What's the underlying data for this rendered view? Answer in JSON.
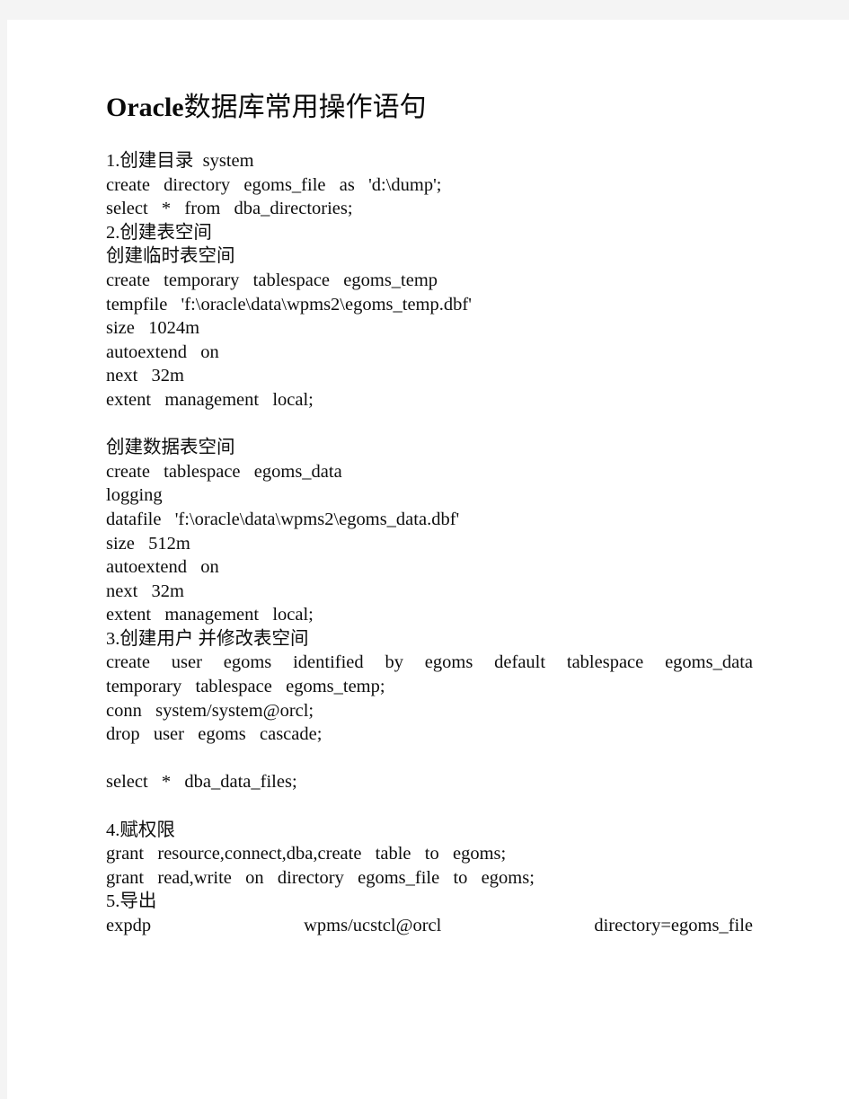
{
  "page": {
    "title_latin": "Oracle",
    "title_cjk": "数据库常用操作语句"
  },
  "document": {
    "lines": [
      {
        "text": "1.创建目录  system",
        "style": "cjk"
      },
      {
        "text": "create  directory  egoms_file  as  'd:\\dump';",
        "style": "plain"
      },
      {
        "text": "select  *  from  dba_directories;",
        "style": "plain"
      },
      {
        "text": "2.创建表空间",
        "style": "cjk"
      },
      {
        "text": "创建临时表空间",
        "style": "cjk"
      },
      {
        "text": "create  temporary  tablespace  egoms_temp",
        "style": "plain"
      },
      {
        "text": "tempfile  'f:\\oracle\\data\\wpms2\\egoms_temp.dbf'",
        "style": "plain"
      },
      {
        "text": "size  1024m",
        "style": "plain"
      },
      {
        "text": "autoextend  on",
        "style": "plain"
      },
      {
        "text": "next  32m",
        "style": "plain"
      },
      {
        "text": "extent  management  local;",
        "style": "plain"
      },
      {
        "text": "",
        "style": "blank"
      },
      {
        "text": "创建数据表空间",
        "style": "cjk"
      },
      {
        "text": "create  tablespace  egoms_data",
        "style": "plain"
      },
      {
        "text": "logging",
        "style": "plain"
      },
      {
        "text": "datafile  'f:\\oracle\\data\\wpms2\\egoms_data.dbf'",
        "style": "plain"
      },
      {
        "text": "size  512m",
        "style": "plain"
      },
      {
        "text": "autoextend  on",
        "style": "plain"
      },
      {
        "text": "next  32m",
        "style": "plain"
      },
      {
        "text": "extent  management  local;",
        "style": "plain"
      },
      {
        "text": "3.创建用户 并修改表空间",
        "style": "cjk"
      },
      {
        "text": "create user egoms identified by egoms default tablespace egoms_data",
        "style": "justified"
      },
      {
        "text": "temporary  tablespace  egoms_temp;",
        "style": "plain"
      },
      {
        "text": "conn  system/system@orcl;",
        "style": "plain"
      },
      {
        "text": "drop  user  egoms  cascade;",
        "style": "plain"
      },
      {
        "text": "",
        "style": "blank"
      },
      {
        "text": "select  *  dba_data_files;",
        "style": "plain"
      },
      {
        "text": "",
        "style": "blank"
      },
      {
        "text": "4.赋权限",
        "style": "cjk"
      },
      {
        "text": "grant  resource,connect,dba,create  table  to  egoms;",
        "style": "plain"
      },
      {
        "text": "grant  read,write  on  directory  egoms_file  to  egoms;",
        "style": "plain"
      },
      {
        "text": "5.导出",
        "style": "cjk"
      },
      {
        "text": "expdp wpms/ucstcl@orcl directory=egoms_file",
        "style": "justified"
      }
    ]
  }
}
